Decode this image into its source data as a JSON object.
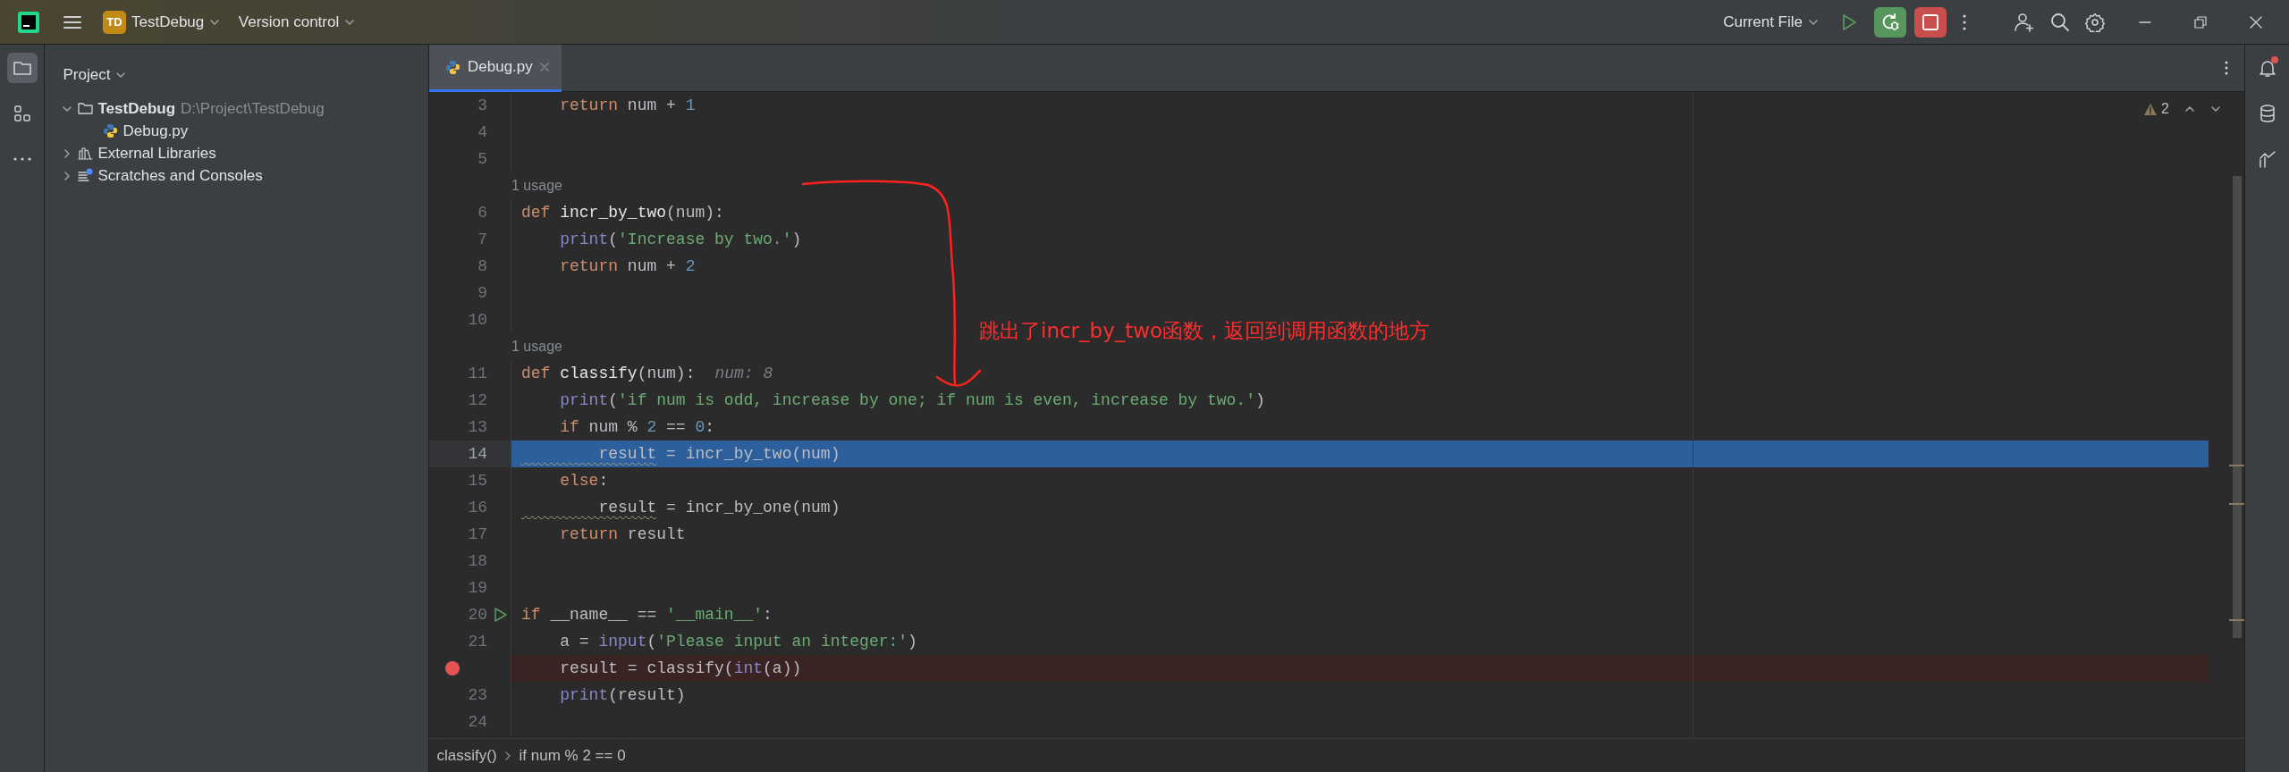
{
  "toolbar": {
    "project_initials": "TD",
    "project": "TestDebug",
    "vcs": "Version control",
    "run_config": "Current File"
  },
  "left_tool_strip": [
    {
      "kind": "folder",
      "selected": true
    },
    {
      "kind": "structure",
      "selected": false
    },
    {
      "kind": "more",
      "selected": false
    }
  ],
  "right_tool_strip": [
    {
      "kind": "bell",
      "badge": true
    },
    {
      "kind": "database",
      "badge": false
    },
    {
      "kind": "chart",
      "badge": false
    }
  ],
  "project_panel": {
    "title": "Project",
    "tree": [
      {
        "kind": "folder",
        "label": "TestDebug",
        "path": "D:\\Project\\TestDebug",
        "expanded": true,
        "selected": false,
        "children": [
          {
            "kind": "python",
            "label": "Debug.py",
            "selected": false
          }
        ]
      },
      {
        "kind": "library",
        "label": "External Libraries",
        "expanded": false,
        "selected": false
      },
      {
        "kind": "scratches",
        "label": "Scratches and Consoles",
        "expanded": false,
        "selected": false
      }
    ]
  },
  "tabs": [
    {
      "label": "Debug.py",
      "selected": true
    }
  ],
  "inspections": {
    "warnings": "2"
  },
  "code": [
    {
      "kind": "code",
      "number": "3",
      "current": false,
      "breakpoint": false,
      "tokens": [
        {
          "kind": "keyword",
          "text": "    return"
        },
        {
          "kind": "plain",
          "text": " num + "
        },
        {
          "kind": "number",
          "text": "1"
        }
      ]
    },
    {
      "kind": "code",
      "number": "4",
      "current": false,
      "breakpoint": false
    },
    {
      "kind": "code",
      "number": "5",
      "current": false,
      "breakpoint": false
    },
    {
      "kind": "usage",
      "text": "1 usage"
    },
    {
      "kind": "code",
      "number": "6",
      "current": false,
      "breakpoint": false,
      "tokens": [
        {
          "kind": "keyword",
          "text": "def "
        },
        {
          "kind": "defname",
          "text": "incr_by_two"
        },
        {
          "kind": "plain",
          "text": "(num):"
        }
      ]
    },
    {
      "kind": "code",
      "number": "7",
      "current": false,
      "breakpoint": false,
      "tokens": [
        {
          "kind": "builtin",
          "text": "    print"
        },
        {
          "kind": "plain",
          "text": "("
        },
        {
          "kind": "string",
          "text": "'Increase by two.'"
        },
        {
          "kind": "plain",
          "text": ")"
        }
      ]
    },
    {
      "kind": "code",
      "number": "8",
      "current": false,
      "breakpoint": false,
      "tokens": [
        {
          "kind": "keyword",
          "text": "    return"
        },
        {
          "kind": "plain",
          "text": " num + "
        },
        {
          "kind": "number",
          "text": "2"
        }
      ]
    },
    {
      "kind": "code",
      "number": "9",
      "current": false,
      "breakpoint": false
    },
    {
      "kind": "code",
      "number": "10",
      "current": false,
      "breakpoint": false
    },
    {
      "kind": "usage",
      "text": "1 usage"
    },
    {
      "kind": "code",
      "number": "11",
      "current": false,
      "breakpoint": false,
      "tokens": [
        {
          "kind": "keyword",
          "text": "def "
        },
        {
          "kind": "defname",
          "text": "classify"
        },
        {
          "kind": "plain",
          "text": "(num):"
        },
        {
          "kind": "hint",
          "text": "num: 8"
        }
      ]
    },
    {
      "kind": "code",
      "number": "12",
      "current": false,
      "breakpoint": false,
      "tokens": [
        {
          "kind": "builtin",
          "text": "    print"
        },
        {
          "kind": "plain",
          "text": "("
        },
        {
          "kind": "string",
          "text": "'if num is odd, increase by one; if num is even, increase by two.'"
        },
        {
          "kind": "plain",
          "text": ")"
        }
      ]
    },
    {
      "kind": "code",
      "number": "13",
      "current": false,
      "breakpoint": false,
      "tokens": [
        {
          "kind": "keyword",
          "text": "    if"
        },
        {
          "kind": "plain",
          "text": " num % "
        },
        {
          "kind": "number",
          "text": "2"
        },
        {
          "kind": "plain",
          "text": " == "
        },
        {
          "kind": "number",
          "text": "0"
        },
        {
          "kind": "plain",
          "text": ":"
        }
      ]
    },
    {
      "kind": "code",
      "number": "14",
      "current": true,
      "breakpoint": false,
      "tokens": [
        {
          "kind": "warned",
          "text": "        result"
        },
        {
          "kind": "plain",
          "text": " = incr_by_two(num)"
        }
      ]
    },
    {
      "kind": "code",
      "number": "15",
      "current": false,
      "breakpoint": false,
      "tokens": [
        {
          "kind": "keyword",
          "text": "    else"
        },
        {
          "kind": "plain",
          "text": ":"
        }
      ]
    },
    {
      "kind": "code",
      "number": "16",
      "current": false,
      "breakpoint": false,
      "tokens": [
        {
          "kind": "warned",
          "text": "        result"
        },
        {
          "kind": "plain",
          "text": " = incr_by_one(num)"
        }
      ]
    },
    {
      "kind": "code",
      "number": "17",
      "current": false,
      "breakpoint": false,
      "tokens": [
        {
          "kind": "keyword",
          "text": "    return"
        },
        {
          "kind": "plain",
          "text": " result"
        }
      ]
    },
    {
      "kind": "code",
      "number": "18",
      "current": false,
      "breakpoint": false
    },
    {
      "kind": "code",
      "number": "19",
      "current": false,
      "breakpoint": false
    },
    {
      "kind": "code",
      "number": "20",
      "current": false,
      "breakpoint": false,
      "runnable": true,
      "tokens": [
        {
          "kind": "keyword",
          "text": "if"
        },
        {
          "kind": "plain",
          "text": " __name__ == "
        },
        {
          "kind": "string",
          "text": "'__main__'"
        },
        {
          "kind": "plain",
          "text": ":"
        }
      ]
    },
    {
      "kind": "code",
      "number": "21",
      "current": false,
      "breakpoint": false,
      "tokens": [
        {
          "kind": "plain",
          "text": "    a = "
        },
        {
          "kind": "builtin",
          "text": "input"
        },
        {
          "kind": "plain",
          "text": "("
        },
        {
          "kind": "string",
          "text": "'Please input an integer:'"
        },
        {
          "kind": "plain",
          "text": ")"
        }
      ]
    },
    {
      "kind": "code",
      "current": false,
      "breakpoint": true,
      "tokens": [
        {
          "kind": "plain",
          "text": "    result = classify("
        },
        {
          "kind": "builtin",
          "text": "int"
        },
        {
          "kind": "plain",
          "text": "(a))"
        }
      ]
    },
    {
      "kind": "code",
      "number": "23",
      "current": false,
      "breakpoint": false,
      "tokens": [
        {
          "kind": "builtin",
          "text": "    print"
        },
        {
          "kind": "plain",
          "text": "(result)"
        }
      ]
    },
    {
      "kind": "code",
      "number": "24",
      "current": false,
      "breakpoint": false
    }
  ],
  "breadcrumbs": [
    "classify()",
    "if num % 2 == 0"
  ],
  "annotation": {
    "text": "跳出了incr_by_two函数，返回到调用函数的地方"
  }
}
